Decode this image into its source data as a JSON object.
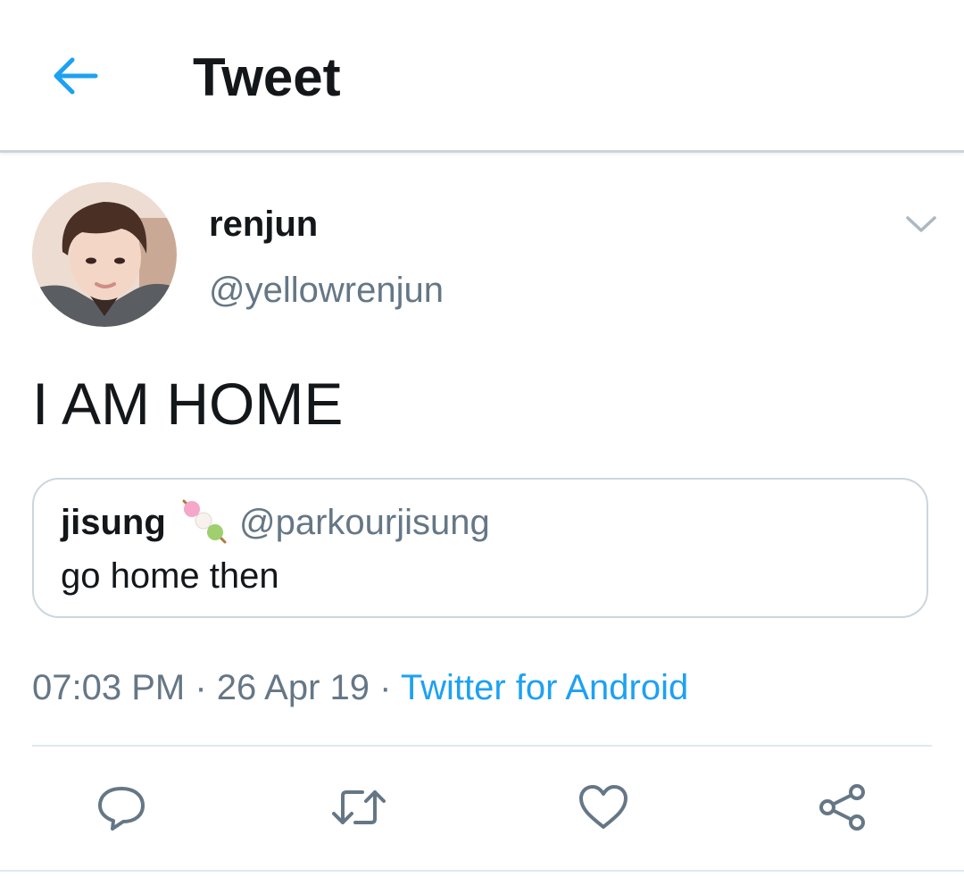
{
  "header": {
    "title": "Tweet",
    "back_icon": "arrow-left-icon",
    "accent_color": "#1da1f2"
  },
  "tweet": {
    "author": {
      "display_name": "renjun",
      "handle": "@yellowrenjun",
      "avatar": "avatar-photo"
    },
    "text": "I AM HOME",
    "quoted": {
      "display_name": "jisung",
      "emoji": "dango-emoji",
      "handle": "@parkourjisung",
      "text": "go home then"
    },
    "meta": {
      "time": "07:03 PM",
      "separator": " · ",
      "date": "26 Apr 19",
      "source": "Twitter for Android"
    }
  },
  "actions": [
    {
      "name": "reply",
      "icon": "reply-icon"
    },
    {
      "name": "retweet",
      "icon": "retweet-icon"
    },
    {
      "name": "like",
      "icon": "heart-icon"
    },
    {
      "name": "share",
      "icon": "share-icon"
    }
  ],
  "colors": {
    "text_primary": "#14171a",
    "text_secondary": "#657786",
    "link": "#1da1f2",
    "border": "#ccd6dd",
    "icon_gray": "#657786"
  }
}
